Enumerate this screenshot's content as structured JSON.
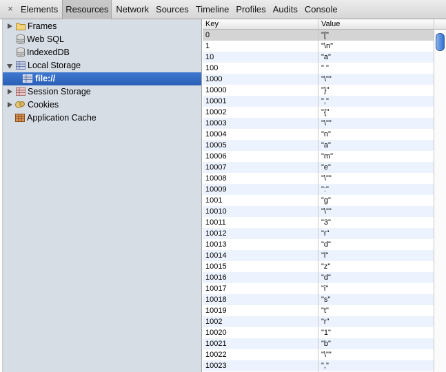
{
  "toolbar": {
    "close_glyph": "×",
    "tabs": [
      "Elements",
      "Resources",
      "Network",
      "Sources",
      "Timeline",
      "Profiles",
      "Audits",
      "Console"
    ],
    "active_tab": "Resources"
  },
  "sidebar": {
    "items": [
      {
        "label": "Frames",
        "icon": "folder-icon",
        "expander": "collapsed"
      },
      {
        "label": "Web SQL",
        "icon": "database-icon",
        "expander": "none"
      },
      {
        "label": "IndexedDB",
        "icon": "database-icon",
        "expander": "none"
      },
      {
        "label": "Local Storage",
        "icon": "storage-grid-icon",
        "expander": "expanded"
      },
      {
        "label": "file://",
        "icon": "storage-grid-icon",
        "expander": "none",
        "selected": true
      },
      {
        "label": "Session Storage",
        "icon": "storage-grid-icon",
        "expander": "collapsed"
      },
      {
        "label": "Cookies",
        "icon": "cookie-icon",
        "expander": "collapsed"
      },
      {
        "label": "Application Cache",
        "icon": "app-cache-icon",
        "expander": "none"
      }
    ]
  },
  "grid": {
    "headers": {
      "key": "Key",
      "value": "Value"
    },
    "rows": [
      {
        "key": "0",
        "value": "\"[\""
      },
      {
        "key": "1",
        "value": "\"\\n\""
      },
      {
        "key": "10",
        "value": "\"a\""
      },
      {
        "key": "100",
        "value": "\" \""
      },
      {
        "key": "1000",
        "value": "\"\\\"\""
      },
      {
        "key": "10000",
        "value": "\"}\""
      },
      {
        "key": "10001",
        "value": "\",\""
      },
      {
        "key": "10002",
        "value": "\"{\""
      },
      {
        "key": "10003",
        "value": "\"\\\"\""
      },
      {
        "key": "10004",
        "value": "\"n\""
      },
      {
        "key": "10005",
        "value": "\"a\""
      },
      {
        "key": "10006",
        "value": "\"m\""
      },
      {
        "key": "10007",
        "value": "\"e\""
      },
      {
        "key": "10008",
        "value": "\"\\\"\""
      },
      {
        "key": "10009",
        "value": "\":\""
      },
      {
        "key": "1001",
        "value": "\"g\""
      },
      {
        "key": "10010",
        "value": "\"\\\"\""
      },
      {
        "key": "10011",
        "value": "\"3\""
      },
      {
        "key": "10012",
        "value": "\"r\""
      },
      {
        "key": "10013",
        "value": "\"d\""
      },
      {
        "key": "10014",
        "value": "\"l\""
      },
      {
        "key": "10015",
        "value": "\"z\""
      },
      {
        "key": "10016",
        "value": "\"d\""
      },
      {
        "key": "10017",
        "value": "\"i\""
      },
      {
        "key": "10018",
        "value": "\"s\""
      },
      {
        "key": "10019",
        "value": "\"t\""
      },
      {
        "key": "1002",
        "value": "\"r\""
      },
      {
        "key": "10020",
        "value": "\"1\""
      },
      {
        "key": "10021",
        "value": "\"b\""
      },
      {
        "key": "10022",
        "value": "\"\\\"\""
      },
      {
        "key": "10023",
        "value": "\",\""
      }
    ]
  },
  "colors": {
    "sidebar_bg": "#d7dde5",
    "selection": "#2f66c0",
    "row_alt": "#edf3fe"
  }
}
